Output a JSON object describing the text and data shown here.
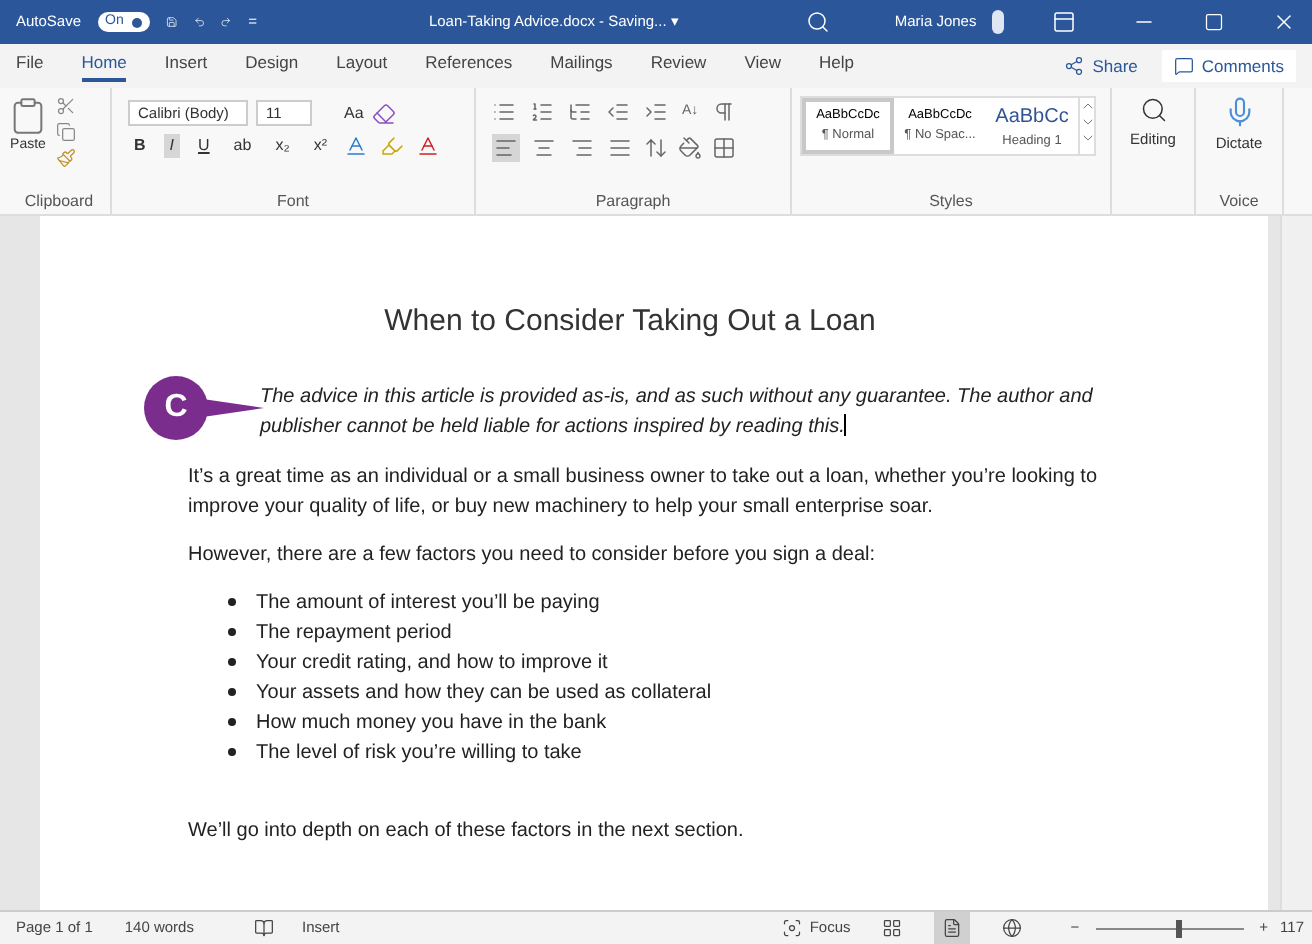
{
  "title_bar": {
    "autosave_label": "AutoSave",
    "autosave": {
      "label": "On",
      "on": true
    },
    "customize": "=",
    "title": "Loan-Taking Advice.docx - Saving... ▾",
    "user": "Maria Jones"
  },
  "tabs": [
    {
      "label": "File",
      "selected": false
    },
    {
      "label": "Home",
      "selected": true
    },
    {
      "label": "Insert",
      "selected": false
    },
    {
      "label": "Design",
      "selected": false
    },
    {
      "label": "Layout",
      "selected": false
    },
    {
      "label": "References",
      "selected": false
    },
    {
      "label": "Mailings",
      "selected": false
    },
    {
      "label": "Review",
      "selected": false
    },
    {
      "label": "View",
      "selected": false
    },
    {
      "label": "Help",
      "selected": false
    }
  ],
  "share": "Share",
  "comments": "Comments",
  "ribbon": {
    "clipboard": {
      "paste": "Paste",
      "label": "Clipboard"
    },
    "font": {
      "face": "Calibri (Body)",
      "size": "11",
      "change_case": "Aa",
      "label": "Font",
      "buttons": [
        {
          "label": "B",
          "selected": false
        },
        {
          "label": "I",
          "selected": true
        },
        {
          "label": "U",
          "selected": false
        },
        {
          "label": "ab",
          "selected": false
        },
        {
          "label": "x₂",
          "selected": false
        },
        {
          "label": "x²",
          "selected": false
        }
      ]
    },
    "paragraph": {
      "label": "Paragraph",
      "sort": "A↓",
      "align": [
        {
          "selected": true
        },
        {
          "selected": false
        },
        {
          "selected": false
        },
        {
          "selected": false
        }
      ]
    },
    "styles": {
      "label": "Styles",
      "items": [
        {
          "preview": "AaBbCcDc",
          "name": "¶ Normal",
          "selected": true,
          "kind": "body"
        },
        {
          "preview": "AaBbCcDc",
          "name": "¶ No Spac...",
          "selected": false,
          "kind": "body"
        },
        {
          "preview": "AaBbCc",
          "name": "Heading 1",
          "selected": false,
          "kind": "heading"
        }
      ]
    },
    "editing": "Editing",
    "dictate": "Dictate",
    "voice": "Voice"
  },
  "document": {
    "heading": "When to Consider Taking Out a Loan",
    "callout": "C",
    "disclaimer": "The advice in this article is provided as-is, and as such without any guarantee. The author and publisher cannot be held liable for actions inspired by reading this.",
    "paragraphs": [
      "It’s a great time as an individual or a small business owner to take out a loan, whether you’re looking to improve your quality of life, or buy new machinery to help your small enterprise soar.",
      "However, there are a few factors you need to consider before you sign a deal:"
    ],
    "bullets": [
      "The amount of interest you’ll be paying",
      "The repayment period",
      "Your credit rating, and how to improve it",
      "Your assets and how they can be used as collateral",
      "How much money you have in the bank",
      "The level of risk you’re willing to take"
    ],
    "closing": "We’ll go into depth on each of these factors in the next section."
  },
  "status_bar": {
    "page": "Page 1 of 1",
    "words": "140 words",
    "mode": "Insert",
    "focus": "Focus",
    "views": [
      {
        "selected": false
      },
      {
        "selected": true
      },
      {
        "selected": false
      }
    ],
    "zoom_minus": "−",
    "zoom_plus": "+",
    "zoom": {
      "level": 0.55
    },
    "zoom_text": "117"
  }
}
